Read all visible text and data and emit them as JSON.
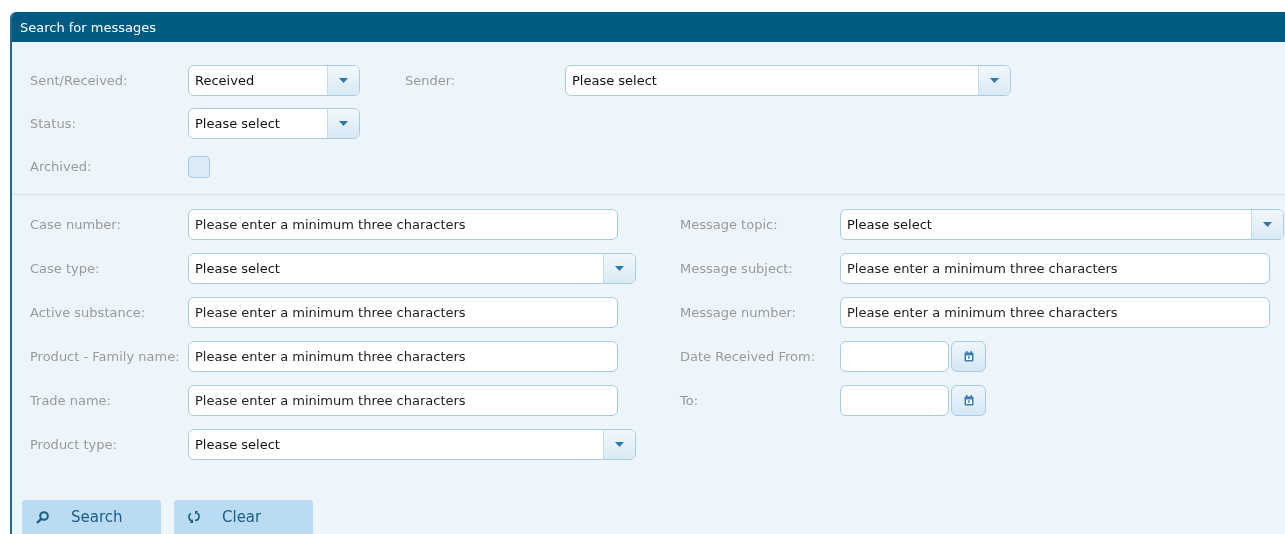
{
  "panel": {
    "title": "Search for messages"
  },
  "top_rows": [
    {
      "fields": [
        {
          "kind": "select",
          "label": "Sent/Received:",
          "value": "Received"
        },
        {
          "kind": "select",
          "label": "Sender:",
          "value": "Please select"
        }
      ]
    },
    {
      "fields": [
        {
          "kind": "select",
          "label": "Status:",
          "value": "Please select"
        }
      ]
    },
    {
      "fields": [
        {
          "kind": "checkbox",
          "label": "Archived:",
          "checked": false
        }
      ]
    }
  ],
  "bottom_rows": [
    {
      "left": {
        "kind": "text",
        "label": "Case number:",
        "placeholder": "Please enter a minimum three characters"
      },
      "right": {
        "kind": "select",
        "label": "Message topic:",
        "value": "Please select"
      }
    },
    {
      "left": {
        "kind": "select",
        "label": "Case type:",
        "value": "Please select"
      },
      "right": {
        "kind": "text",
        "label": "Message subject:",
        "placeholder": "Please enter a minimum three characters"
      }
    },
    {
      "left": {
        "kind": "text",
        "label": "Active substance:",
        "placeholder": "Please enter a minimum three characters"
      },
      "right": {
        "kind": "text",
        "label": "Message number:",
        "placeholder": "Please enter a minimum three characters"
      }
    },
    {
      "left": {
        "kind": "text",
        "label": "Product - Family name:",
        "placeholder": "Please enter a minimum three characters"
      },
      "right": {
        "kind": "date",
        "label": "Date Received From:"
      }
    },
    {
      "left": {
        "kind": "text",
        "label": "Trade name:",
        "placeholder": "Please enter a minimum three characters"
      },
      "right": {
        "kind": "date",
        "label": "To:"
      }
    },
    {
      "left": {
        "kind": "select",
        "label": "Product type:",
        "value": "Please select"
      }
    }
  ],
  "buttons": [
    {
      "kind": "search",
      "label": "Search"
    },
    {
      "kind": "clear",
      "label": "Clear"
    }
  ]
}
